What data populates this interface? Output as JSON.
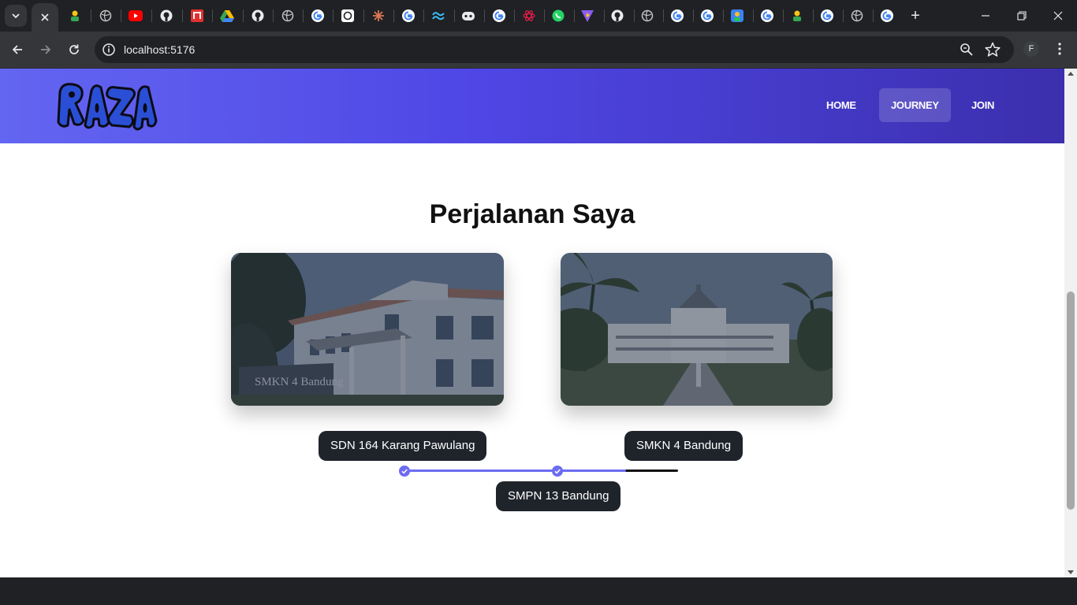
{
  "browser": {
    "url": "localhost:5176",
    "profile_initial": "F",
    "tab_icons": [
      "person-icon",
      "globe-icon",
      "youtube-icon",
      "github-icon",
      "notion-icon",
      "drive-icon",
      "github-icon",
      "globe-icon",
      "google-icon",
      "openai-icon",
      "claude-icon",
      "google-icon",
      "tailwind-icon",
      "bot-icon",
      "google-icon",
      "react-icon",
      "whatsapp-icon",
      "vite-icon",
      "github-icon",
      "globe-icon",
      "google-icon",
      "google-icon",
      "person-icon",
      "google-icon",
      "person-icon",
      "google-icon",
      "globe-icon",
      "google-icon"
    ]
  },
  "site": {
    "logo_text": "RAZA",
    "nav": [
      {
        "label": "HOME",
        "active": false
      },
      {
        "label": "JOURNEY",
        "active": true
      },
      {
        "label": "JOIN",
        "active": false
      }
    ],
    "title": "Perjalanan Saya",
    "cards": [
      {
        "caption": "SMKN 4 Bandung",
        "subject": "school-building-photo"
      },
      {
        "caption": "",
        "subject": "gedung-sate-photo"
      }
    ],
    "timeline": [
      {
        "label": "SDN 164 Karang Pawulang",
        "done": true
      },
      {
        "label": "SMPN 13 Bandung",
        "done": true
      },
      {
        "label": "SMKN 4 Bandung",
        "done": false
      }
    ],
    "progress_percent": 81,
    "colors": {
      "accent": "#6c6cf2",
      "header_start": "#6366f1",
      "header_end": "#3b2fad",
      "pill_bg": "#1f242b"
    }
  }
}
